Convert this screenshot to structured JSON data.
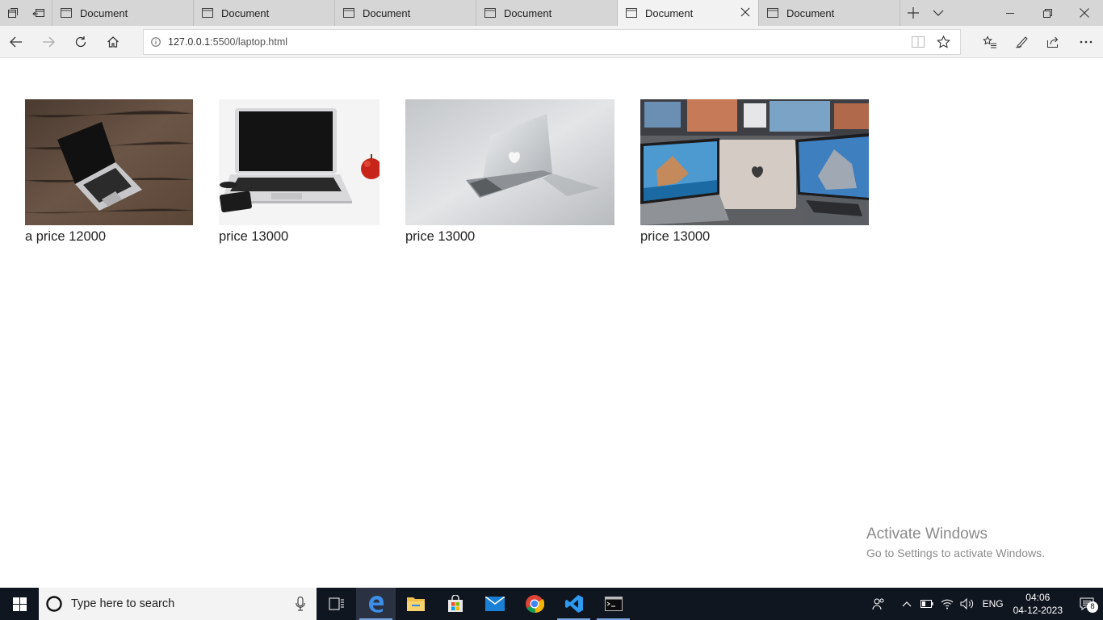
{
  "browser": {
    "tabs": [
      {
        "label": "Document",
        "active": false
      },
      {
        "label": "Document",
        "active": false
      },
      {
        "label": "Document",
        "active": false
      },
      {
        "label": "Document",
        "active": false
      },
      {
        "label": "Document",
        "active": true
      },
      {
        "label": "Document",
        "active": false
      }
    ],
    "address": {
      "host": "127.0.0.1",
      "path": ":5500/laptop.html"
    }
  },
  "products": [
    {
      "caption": "a price 12000",
      "image": "laptop-on-wooden-desk"
    },
    {
      "caption": "price 13000",
      "image": "laptop-with-apple-and-phone"
    },
    {
      "caption": "price 13000",
      "image": "laptop-back-silver"
    },
    {
      "caption": "price 13000",
      "image": "laptops-in-store"
    }
  ],
  "watermark": {
    "title": "Activate Windows",
    "subtitle": "Go to Settings to activate Windows."
  },
  "taskbar": {
    "search_placeholder": "Type here to search",
    "language": "ENG",
    "time": "04:06",
    "date": "04-12-2023",
    "notification_count": "8"
  },
  "colors": {
    "accent": "#0078d7",
    "taskbar": "#101620",
    "tabbar": "#d6d6d6"
  }
}
